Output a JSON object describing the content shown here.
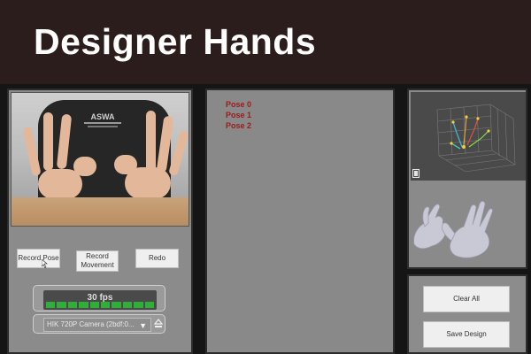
{
  "banner": {
    "title": "Designer Hands"
  },
  "controls": {
    "record_pose_label": "Record Pose",
    "record_movement_label": "Record Movement",
    "redo_label": "Redo"
  },
  "fps": {
    "text": "30 fps",
    "bars": 10
  },
  "camera": {
    "selected": "HIK 720P Camera (2bdf:0..."
  },
  "poses": [
    "Pose 0",
    "Pose 1",
    "Pose 2"
  ],
  "design": {
    "clear_label": "Clear All",
    "save_label": "Save Design"
  },
  "colors": {
    "pose_text": "#9e1a1a",
    "fps_bar": "#2fae3a",
    "banner_bg": "#2b1d1b"
  },
  "icons": {
    "dropdown": "chevron-down-icon",
    "eject": "eject-icon",
    "cursor": "cursor-icon"
  }
}
